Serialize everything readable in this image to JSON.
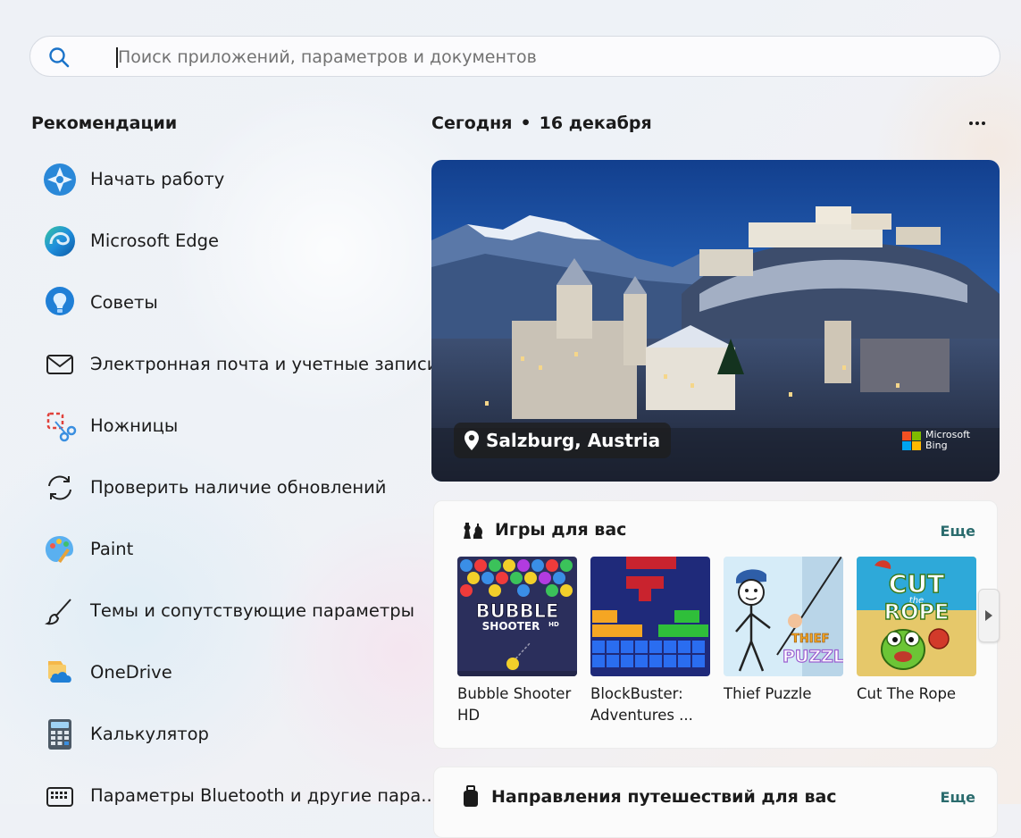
{
  "search": {
    "placeholder": "Поиск приложений, параметров и документов",
    "value": ""
  },
  "recommendations": {
    "title": "Рекомендации",
    "items": [
      {
        "label": "Начать работу",
        "icon": "get-started-icon"
      },
      {
        "label": "Microsoft Edge",
        "icon": "edge-icon"
      },
      {
        "label": "Советы",
        "icon": "tips-icon"
      },
      {
        "label": "Электронная почта и учетные записи",
        "icon": "mail-icon"
      },
      {
        "label": "Ножницы",
        "icon": "snipping-tool-icon"
      },
      {
        "label": "Проверить наличие обновлений",
        "icon": "refresh-icon"
      },
      {
        "label": "Paint",
        "icon": "paint-icon"
      },
      {
        "label": "Темы и сопутствующие параметры",
        "icon": "brush-icon"
      },
      {
        "label": "OneDrive",
        "icon": "onedrive-icon"
      },
      {
        "label": "Калькулятор",
        "icon": "calculator-icon"
      },
      {
        "label": "Параметры Bluetooth и другие пара...",
        "icon": "keyboard-icon"
      }
    ]
  },
  "today": {
    "label": "Сегодня",
    "separator": "•",
    "date": "16 декабря"
  },
  "hero": {
    "location": "Salzburg, Austria",
    "brand_line1": "Microsoft",
    "brand_line2": "Bing"
  },
  "games": {
    "title": "Игры для вас",
    "more": "Еще",
    "tiles": [
      {
        "name": "Bubble Shooter HD",
        "logo_text1": "BUBBLE",
        "logo_text2": "SHOOTER",
        "logo_text3": "HD"
      },
      {
        "name": "BlockBuster: Adventures ..."
      },
      {
        "name": "Thief Puzzle",
        "logo_text1": "THIEF",
        "logo_text2": "PUZZLE"
      },
      {
        "name": "Cut The Rope",
        "logo_text1": "CUT",
        "logo_text2": "the",
        "logo_text3": "ROPE"
      }
    ]
  },
  "travel": {
    "title": "Направления путешествий для вас",
    "more": "Еще"
  },
  "colors": {
    "accent_link": "#2a6b6d",
    "search_icon": "#1a73c9"
  }
}
